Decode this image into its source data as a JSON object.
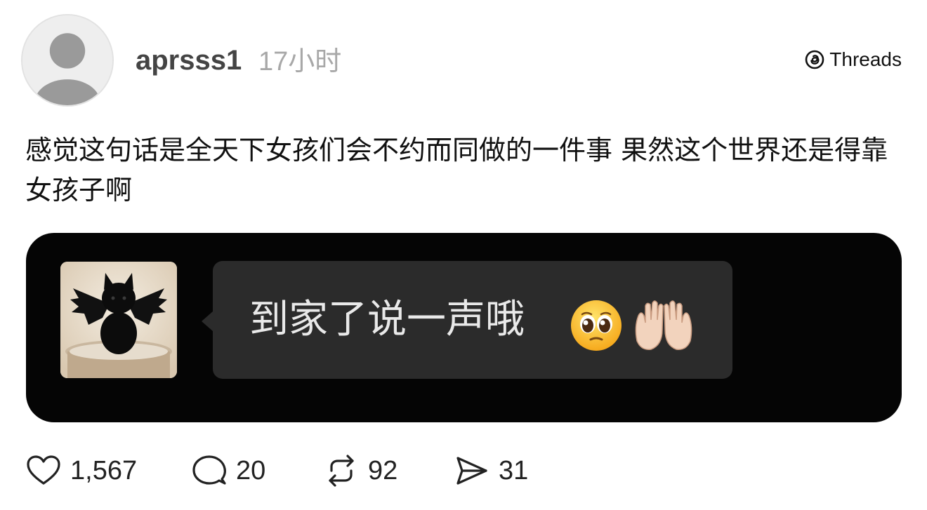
{
  "post": {
    "username": "aprsss1",
    "time": "17小时",
    "brand": "Threads",
    "text": "感觉这句话是全天下女孩们会不约而同做的一件事 果然这个世界还是得靠女孩子啊"
  },
  "media": {
    "message_text": "到家了说一声哦",
    "emojis": [
      "pleading-face-icon",
      "raised-hands-icon"
    ]
  },
  "actions": {
    "likes": "1,567",
    "comments": "20",
    "reposts": "92",
    "shares": "31"
  },
  "colors": {
    "background": "#ffffff",
    "media_bg": "#050505",
    "bubble_bg": "#2b2b2b",
    "muted_text": "#a8a8a8"
  }
}
